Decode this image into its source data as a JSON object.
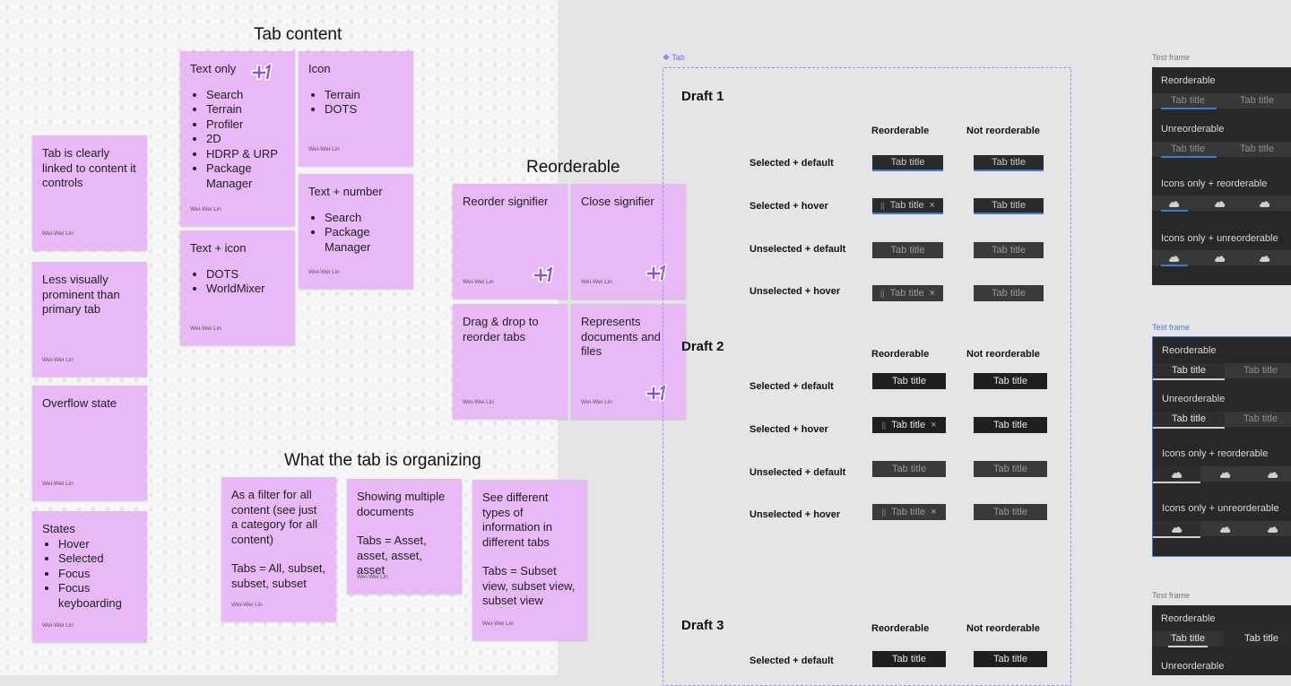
{
  "board": {
    "headings": {
      "tab_content": "Tab content",
      "reorderable": "Reorderable",
      "organizing": "What the tab is organizing"
    },
    "author": "Wei-Wei Lin",
    "vote_label": "+1",
    "left_column": [
      {
        "text": "Tab is clearly linked to content it controls"
      },
      {
        "text": "Less visually prominent than primary tab"
      },
      {
        "text": "Overflow state"
      },
      {
        "title": "States",
        "items": [
          "Hover",
          "Selected",
          "Focus",
          "Focus keyboarding"
        ]
      }
    ],
    "tab_content": [
      {
        "title": "Text only",
        "items": [
          "Search",
          "Terrain",
          "Profiler",
          "2D",
          "HDRP & URP",
          "Package Manager"
        ]
      },
      {
        "title": "Icon",
        "items": [
          "Terrain",
          "DOTS"
        ]
      },
      {
        "title": "Text + number",
        "items": [
          "Search",
          "Package Manager"
        ]
      },
      {
        "title": "Text + icon",
        "items": [
          "DOTS",
          "WorldMixer"
        ]
      }
    ],
    "reorderable": [
      "Reorder signifier",
      "Close signifier",
      "Drag & drop to reorder tabs",
      "Represents documents and files"
    ],
    "organizing": [
      {
        "lines": [
          "As a filter for all content (see just a category for all content)",
          "Tabs = All, subset, subset, subset"
        ]
      },
      {
        "lines": [
          "Showing multiple documents",
          "Tabs = Asset, asset, asset, asset"
        ]
      },
      {
        "lines": [
          "See different types of information in different tabs",
          "Tabs = Subset view, subset view, subset view"
        ]
      }
    ]
  },
  "tab_frame": {
    "label": "Tab",
    "col_reorderable": "Reorderable",
    "col_not_reorderable": "Not reorderable",
    "tab_title": "Tab title",
    "grip": "||",
    "close": "×",
    "drafts": [
      "Draft 1",
      "Draft 2",
      "Draft 3"
    ],
    "row_labels": [
      "Selected + default",
      "Selected + hover",
      "Unselected + default",
      "Unselected + hover"
    ]
  },
  "test_frames": {
    "label": "Test frame",
    "reorderable": "Reorderable",
    "unreorderable": "Unreorderable",
    "icons_reorderable": "Icons only + reorderable",
    "icons_unreorderable": "Icons only + unreorderable",
    "tab_title": "Tab title"
  },
  "colors": {
    "sticky": "#e9b8f7",
    "accent_purple": "#7b61ff",
    "selection_blue": "#3d7cd6",
    "panel_dark": "#282828"
  }
}
